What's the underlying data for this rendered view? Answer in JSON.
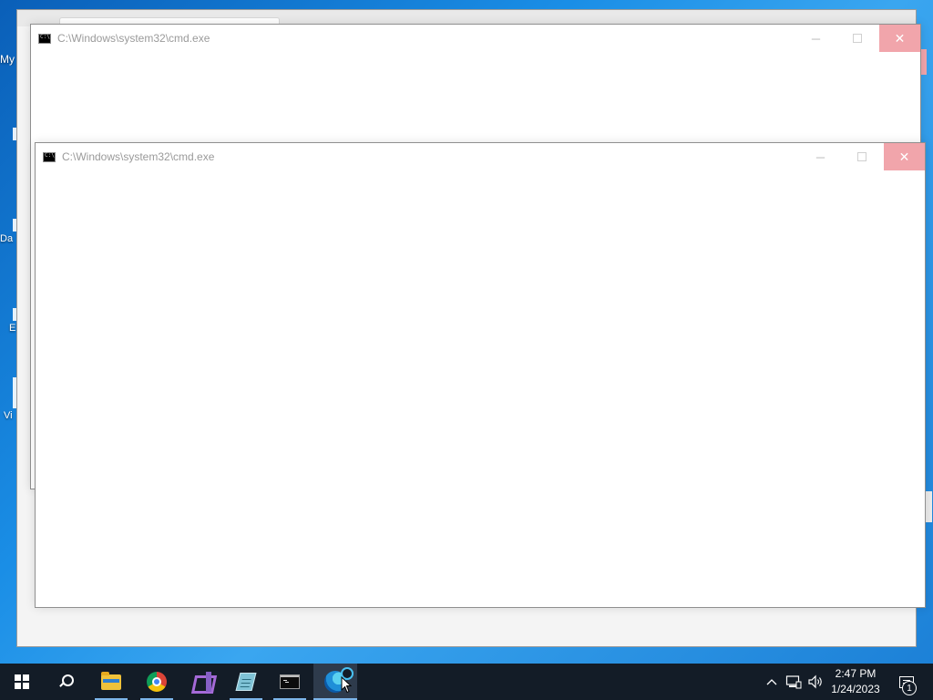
{
  "desktop": {
    "icons": [
      {
        "label": "My",
        "name": "desktop-icon-my"
      },
      {
        "label": "",
        "name": "desktop-icon-2"
      },
      {
        "label": "Da",
        "name": "desktop-icon-da"
      },
      {
        "label": "E",
        "name": "desktop-icon-e"
      },
      {
        "label": "Vi",
        "name": "desktop-icon-vi"
      }
    ]
  },
  "windows": {
    "cmd_back": {
      "title": "C:\\Windows\\system32\\cmd.exe",
      "minimize": "─",
      "close": "✕"
    },
    "cmd_front": {
      "title": "C:\\Windows\\system32\\cmd.exe",
      "minimize": "─",
      "close": "✕"
    }
  },
  "taskbar": {
    "items": [
      "start",
      "search",
      "file-explorer",
      "chrome",
      "visual-studio",
      "notepad",
      "command-prompt",
      "edge"
    ],
    "tray_up": "^",
    "time": "2:47 PM",
    "date": "1/24/2023",
    "notification_count": "1"
  },
  "colors": {
    "close_button": "#f1a5ab",
    "taskbar": "#131c27",
    "desktop": "#1a8ee6"
  }
}
